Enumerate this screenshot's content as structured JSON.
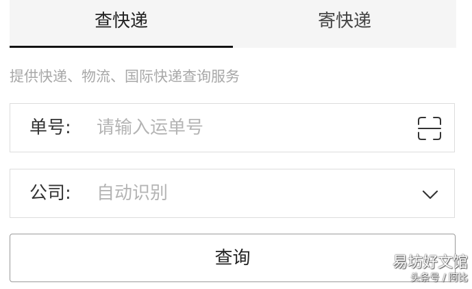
{
  "tabs": [
    {
      "label": "查快递",
      "active": true
    },
    {
      "label": "寄快递",
      "active": false
    }
  ],
  "subtitle": "提供快递、物流、国际快递查询服务",
  "tracking_field": {
    "label": "单号:",
    "placeholder": "请输入运单号",
    "value": "",
    "icon": "scan-icon"
  },
  "company_field": {
    "label": "公司:",
    "selected_value": "自动识别",
    "icon": "chevron-down-icon"
  },
  "query_button": {
    "label": "查询"
  },
  "watermark": {
    "main": "易坊好文馆",
    "sub": "头条号 / 阿比"
  },
  "colors": {
    "tab_background": "#f5f5f5",
    "active_underline": "#111111",
    "placeholder": "#b4b4b4",
    "border": "#dcdcdc"
  }
}
